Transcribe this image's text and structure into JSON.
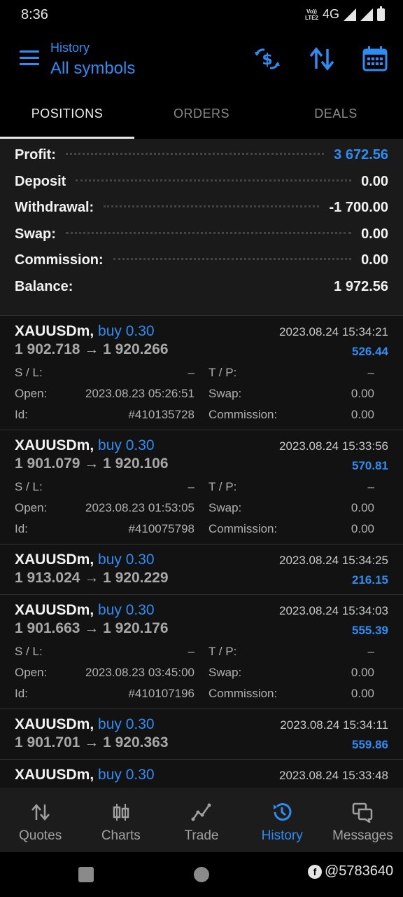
{
  "status_bar": {
    "time": "8:36",
    "volte": "Vo)) LTE2",
    "network": "4G"
  },
  "app_bar": {
    "subtitle": "History",
    "title": "All symbols"
  },
  "tabs": [
    {
      "label": "POSITIONS",
      "active": true
    },
    {
      "label": "ORDERS",
      "active": false
    },
    {
      "label": "DEALS",
      "active": false
    }
  ],
  "summary": {
    "profit_label": "Profit:",
    "profit_value": "3 672.56",
    "deposit_label": "Deposit",
    "deposit_value": "0.00",
    "withdrawal_label": "Withdrawal:",
    "withdrawal_value": "-1 700.00",
    "swap_label": "Swap:",
    "swap_value": "0.00",
    "commission_label": "Commission:",
    "commission_value": "0.00",
    "balance_label": "Balance:",
    "balance_value": "1 972.56"
  },
  "detail_labels": {
    "sl": "S / L:",
    "tp": "T / P:",
    "open": "Open:",
    "swap": "Swap:",
    "id": "Id:",
    "commission": "Commission:"
  },
  "deals": [
    {
      "symbol": "XAUUSDm,",
      "side": "buy 0.30",
      "price": "1 902.718 → 1 920.266",
      "date": "2023.08.24 15:34:21",
      "pl": "526.44",
      "sl": "–",
      "tp": "–",
      "open": "2023.08.23 05:26:51",
      "swap": "0.00",
      "id": "#410135728",
      "commission": "0.00"
    },
    {
      "symbol": "XAUUSDm,",
      "side": "buy 0.30",
      "price": "1 901.079 → 1 920.106",
      "date": "2023.08.24 15:33:56",
      "pl": "570.81",
      "sl": "–",
      "tp": "–",
      "open": "2023.08.23 01:53:05",
      "swap": "0.00",
      "id": "#410075798",
      "commission": "0.00"
    },
    {
      "symbol": "XAUUSDm,",
      "side": "buy 0.30",
      "price": "1 913.024 → 1 920.229",
      "date": "2023.08.24 15:34:25",
      "pl": "216.15"
    },
    {
      "symbol": "XAUUSDm,",
      "side": "buy 0.30",
      "price": "1 901.663 → 1 920.176",
      "date": "2023.08.24 15:34:03",
      "pl": "555.39",
      "sl": "–",
      "tp": "–",
      "open": "2023.08.23 03:45:00",
      "swap": "0.00",
      "id": "#410107196",
      "commission": "0.00"
    },
    {
      "symbol": "XAUUSDm,",
      "side": "buy 0.30",
      "price": "1 901.701 → 1 920.363",
      "date": "2023.08.24 15:34:11",
      "pl": "559.86"
    },
    {
      "symbol": "XAUUSDm,",
      "side": "buy 0.30",
      "date": "2023.08.24 15:33:48"
    }
  ],
  "bottom_nav": [
    {
      "label": "Quotes",
      "icon": "quotes-icon",
      "active": false
    },
    {
      "label": "Charts",
      "icon": "charts-icon",
      "active": false
    },
    {
      "label": "Trade",
      "icon": "trade-icon",
      "active": false
    },
    {
      "label": "History",
      "icon": "history-icon",
      "active": true
    },
    {
      "label": "Messages",
      "icon": "messages-icon",
      "active": false
    }
  ],
  "watermark": "@5783640",
  "colors": {
    "accent": "#2f8df2",
    "background": "#121212",
    "summary_bg": "#1a1a1a"
  }
}
